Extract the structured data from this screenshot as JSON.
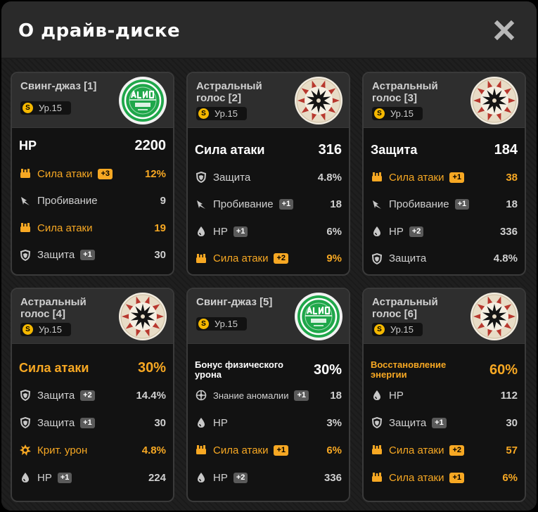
{
  "window": {
    "title": "О драйв-диске"
  },
  "colors": {
    "accent": "#f7a823",
    "background": "#1c1c1c",
    "card": "#121212"
  },
  "cards": [
    {
      "name": "Свинг-джаз [1]",
      "level": "Ур.15",
      "disc": "swing-jazz",
      "main": {
        "name": "HP",
        "value": "2200",
        "highlight": false
      },
      "subs": [
        {
          "icon": "attack-icon",
          "name": "Сила атаки",
          "up": "+3",
          "value": "12%",
          "highlight": true
        },
        {
          "icon": "pierce-icon",
          "name": "Пробивание",
          "up": "",
          "value": "9",
          "highlight": false
        },
        {
          "icon": "attack-icon",
          "name": "Сила атаки",
          "up": "",
          "value": "19",
          "highlight": true
        },
        {
          "icon": "defense-icon",
          "name": "Защита",
          "up": "+1",
          "value": "30",
          "highlight": false
        }
      ]
    },
    {
      "name": "Астральный голос [2]",
      "level": "Ур.15",
      "disc": "astral-voice",
      "main": {
        "name": "Сила атаки",
        "value": "316",
        "highlight": false
      },
      "subs": [
        {
          "icon": "defense-icon",
          "name": "Защита",
          "up": "",
          "value": "4.8%",
          "highlight": false
        },
        {
          "icon": "pierce-icon",
          "name": "Пробивание",
          "up": "+1",
          "value": "18",
          "highlight": false
        },
        {
          "icon": "hp-icon",
          "name": "HP",
          "up": "+1",
          "value": "6%",
          "highlight": false
        },
        {
          "icon": "attack-icon",
          "name": "Сила атаки",
          "up": "+2",
          "value": "9%",
          "highlight": true
        }
      ]
    },
    {
      "name": "Астральный голос [3]",
      "level": "Ур.15",
      "disc": "astral-voice",
      "main": {
        "name": "Защита",
        "value": "184",
        "highlight": false
      },
      "subs": [
        {
          "icon": "attack-icon",
          "name": "Сила атаки",
          "up": "+1",
          "value": "38",
          "highlight": true
        },
        {
          "icon": "pierce-icon",
          "name": "Пробивание",
          "up": "+1",
          "value": "18",
          "highlight": false
        },
        {
          "icon": "hp-icon",
          "name": "HP",
          "up": "+2",
          "value": "336",
          "highlight": false
        },
        {
          "icon": "defense-icon",
          "name": "Защита",
          "up": "",
          "value": "4.8%",
          "highlight": false
        }
      ]
    },
    {
      "name": "Астральный голос [4]",
      "level": "Ур.15",
      "disc": "astral-voice",
      "main": {
        "name": "Сила атаки",
        "value": "30%",
        "highlight": true
      },
      "subs": [
        {
          "icon": "defense-icon",
          "name": "Защита",
          "up": "+2",
          "value": "14.4%",
          "highlight": false
        },
        {
          "icon": "defense-icon",
          "name": "Защита",
          "up": "+1",
          "value": "30",
          "highlight": false
        },
        {
          "icon": "crit-icon",
          "name": "Крит. урон",
          "up": "",
          "value": "4.8%",
          "highlight": true
        },
        {
          "icon": "hp-icon",
          "name": "HP",
          "up": "+1",
          "value": "224",
          "highlight": false
        }
      ]
    },
    {
      "name": "Свинг-джаз [5]",
      "level": "Ур.15",
      "disc": "swing-jazz",
      "main": {
        "name": "Бонус физического урона",
        "value": "30%",
        "highlight": false
      },
      "subs": [
        {
          "icon": "anomaly-icon",
          "name": "Знание аномалии",
          "up": "+1",
          "value": "18",
          "highlight": false
        },
        {
          "icon": "hp-icon",
          "name": "HP",
          "up": "",
          "value": "3%",
          "highlight": false
        },
        {
          "icon": "attack-icon",
          "name": "Сила атаки",
          "up": "+1",
          "value": "6%",
          "highlight": true
        },
        {
          "icon": "hp-icon",
          "name": "HP",
          "up": "+2",
          "value": "336",
          "highlight": false
        }
      ]
    },
    {
      "name": "Астральный голос [6]",
      "level": "Ур.15",
      "disc": "astral-voice",
      "main": {
        "name": "Восстановление энергии",
        "value": "60%",
        "highlight": true
      },
      "subs": [
        {
          "icon": "hp-icon",
          "name": "HP",
          "up": "",
          "value": "112",
          "highlight": false
        },
        {
          "icon": "defense-icon",
          "name": "Защита",
          "up": "+1",
          "value": "30",
          "highlight": false
        },
        {
          "icon": "attack-icon",
          "name": "Сила атаки",
          "up": "+2",
          "value": "57",
          "highlight": true
        },
        {
          "icon": "attack-icon",
          "name": "Сила атаки",
          "up": "+1",
          "value": "6%",
          "highlight": true
        }
      ]
    }
  ]
}
